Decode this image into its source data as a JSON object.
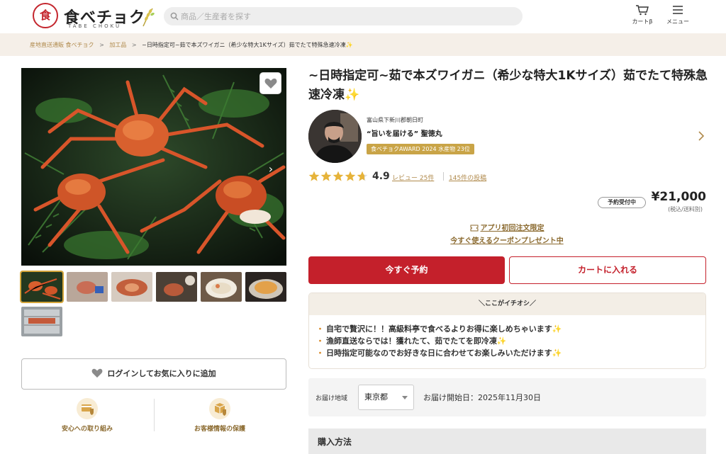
{
  "header": {
    "logo_text": "食べチョク",
    "logo_sub": "TABE CHOKU",
    "logo_mark": "食",
    "search_placeholder": "商品／生産者を探す",
    "cart_label": "カートβ",
    "menu_label": "メニュー"
  },
  "breadcrumb": [
    "産地直送通販 食べチョク",
    "加工品",
    "~日時指定可~茹で本ズワイガニ（希少な特大1Kサイズ）茹でたて特殊急速冷凍✨"
  ],
  "product": {
    "title": "~日時指定可~茹で本ズワイガニ（希少な特大1Kサイズ）茹でたて特殊急速冷凍✨",
    "rating": "4.9",
    "rating_stars": 4.9,
    "reviews_label": "レビュー 25件",
    "posts_label": "145件の投稿",
    "status": "予約受付中",
    "price": "¥21,000",
    "price_note": "(税込/送料別)",
    "image_count": 7,
    "selected_image": 1
  },
  "producer": {
    "location": "富山県下新川郡朝日町",
    "name": "“旨いを届ける” 聖徳丸",
    "award": "食べチョクAWARD 2024 水産物 23位"
  },
  "coupon": {
    "line1": "アプリ初回注文限定",
    "line2": "今すぐ使えるクーポンプレゼント中"
  },
  "actions": {
    "reserve": "今すぐ予約",
    "add_cart": "カートに入れる",
    "login_fav": "ログインしてお気に入りに追加"
  },
  "highlights": {
    "title": "＼ここがイチオシ／",
    "items": [
      "自宅で贅沢に！！高級料亭で食べるよりお得に楽しめちゃいます✨",
      "漁師直送ならでは！獲れたて、茹でたてを即冷凍✨",
      "日時指定可能なのでお好きな日に合わせてお楽しみいただけます✨"
    ]
  },
  "delivery": {
    "label": "お届け地域",
    "region": "東京都",
    "start_date": "お届け開始日：2025年11月30日"
  },
  "trust": {
    "safety": "安心への取り組み",
    "privacy": "お客様情報の保護"
  },
  "section": {
    "howto": "購入方法"
  },
  "colors": {
    "brand_red": "#c4202b",
    "gold": "#c9a447",
    "link": "#b08a4c",
    "breadcrumb_bg": "#f5efe8"
  }
}
